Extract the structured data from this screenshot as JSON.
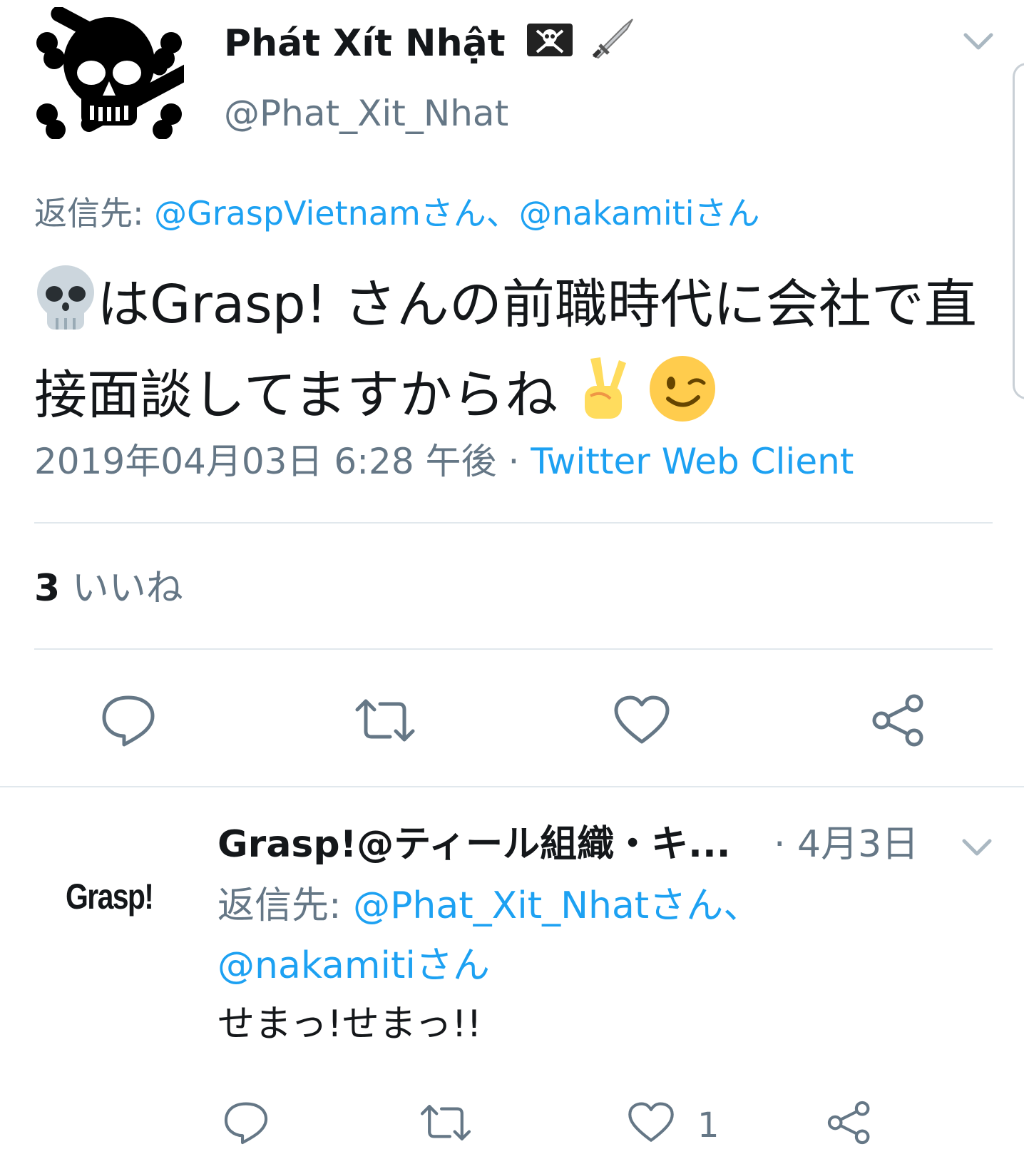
{
  "main_tweet": {
    "display_name": "Phát Xít Nhật",
    "handle": "@Phat_Xit_Nhat",
    "reply_to": {
      "label": "返信先:",
      "mention1": "@GraspVietnamさん",
      "separator": "、",
      "mention2": "@nakamitiさん"
    },
    "body": "はGrasp! さんの前職時代に会社で直接面談してますからね",
    "timestamp": "2019年04月03日 6:28 午後",
    "dot": " · ",
    "source": "Twitter Web Client",
    "likes_count": "3",
    "likes_label": "いいね"
  },
  "reply_tweet": {
    "avatar_text": "Grasp!",
    "display_name": "Grasp!@ティール組織・キ...",
    "time": "· 4月3日",
    "reply_to": {
      "label": "返信先:",
      "mention1": "@Phat_Xit_Nhatさん",
      "separator": "、",
      "mention2": "@nakamitiさん"
    },
    "body": "せまっ!せまっ!!",
    "like_count": "1"
  },
  "icons": [
    "skull-crossbones-icon",
    "pirate-flag-icon",
    "dagger-icon",
    "skull-icon",
    "victory-hand-icon",
    "winking-face-icon",
    "chevron-down-icon",
    "reply-icon",
    "retweet-icon",
    "like-icon",
    "share-icon"
  ],
  "colors": {
    "link": "#1da1f2",
    "muted": "#657786",
    "text": "#14171a",
    "divider": "#e1e8ed"
  }
}
